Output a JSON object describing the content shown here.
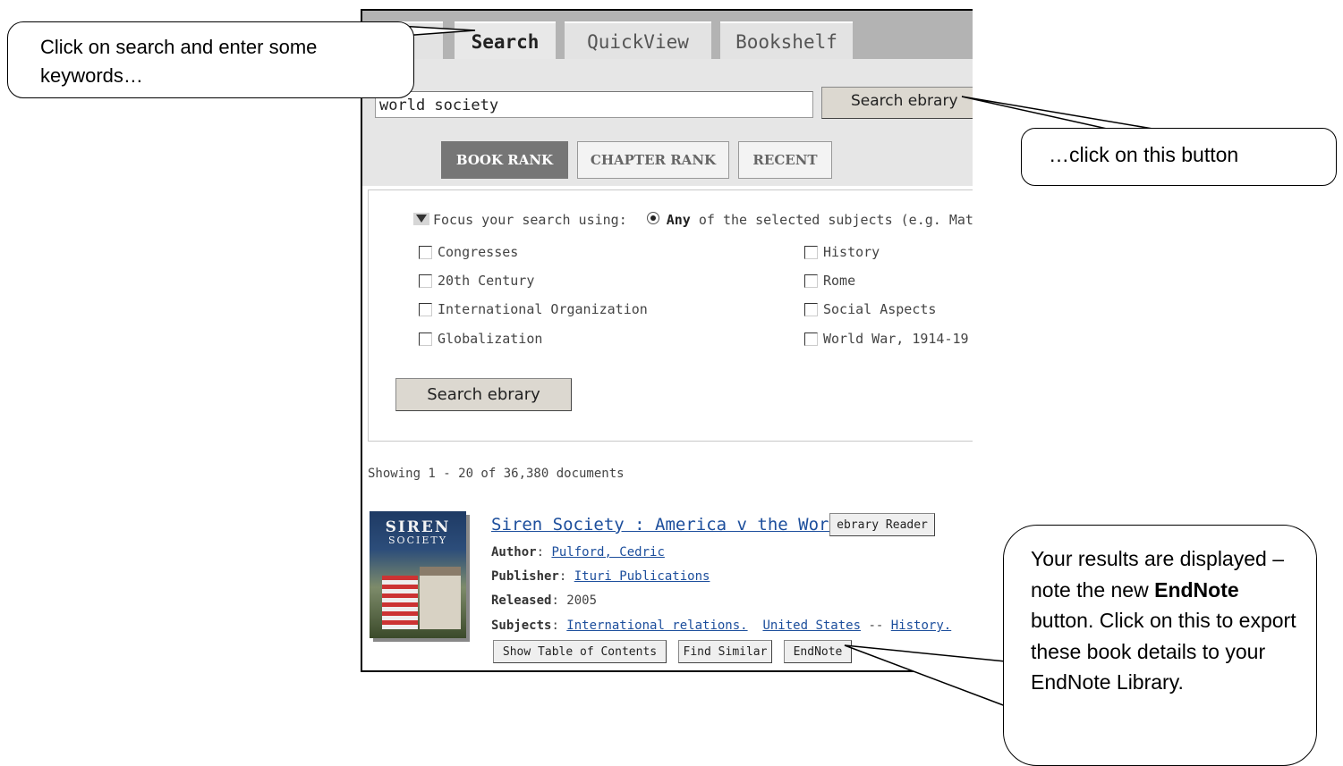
{
  "tabs": [
    "Search",
    "QuickView",
    "Bookshelf"
  ],
  "search": {
    "value": "world society",
    "button": "Search ebrary"
  },
  "rank_tabs": [
    "BOOK RANK",
    "CHAPTER RANK",
    "RECENT"
  ],
  "focus": {
    "label": "Focus your search using:",
    "any": "Any",
    "rest": "of the selected subjects (e.g. Math O",
    "left": [
      "Congresses",
      "20th Century",
      "International Organization",
      "Globalization"
    ],
    "right": [
      "History",
      "Rome",
      "Social Aspects",
      "World War, 1914-19"
    ],
    "button": "Search ebrary"
  },
  "showing": "Showing 1 - 20 of 36,380 documents",
  "result": {
    "cover_title": "SIREN",
    "cover_sub": "SOCIETY",
    "title": "Siren Society : America v the World",
    "reader_button": "ebrary Reader",
    "author_label": "Author",
    "author": "Pulford, Cedric",
    "publisher_label": "Publisher",
    "publisher": "Ituri Publications",
    "released_label": "Released",
    "released": "2005",
    "subjects_label": "Subjects",
    "subject1": "International relations.",
    "subject2": "United States",
    "separator": "--",
    "subject3": "History.",
    "buttons": [
      "Show Table of Contents",
      "Find Similar",
      "EndNote"
    ]
  },
  "callouts": {
    "c1": "Click on search and enter some keywords…",
    "c2": "…click on this button",
    "c3_a": "Your results are displayed – note the new",
    "c3_bold": "EndNote",
    "c3_b": "button. Click on this to export these book details to your EndNote Library."
  }
}
